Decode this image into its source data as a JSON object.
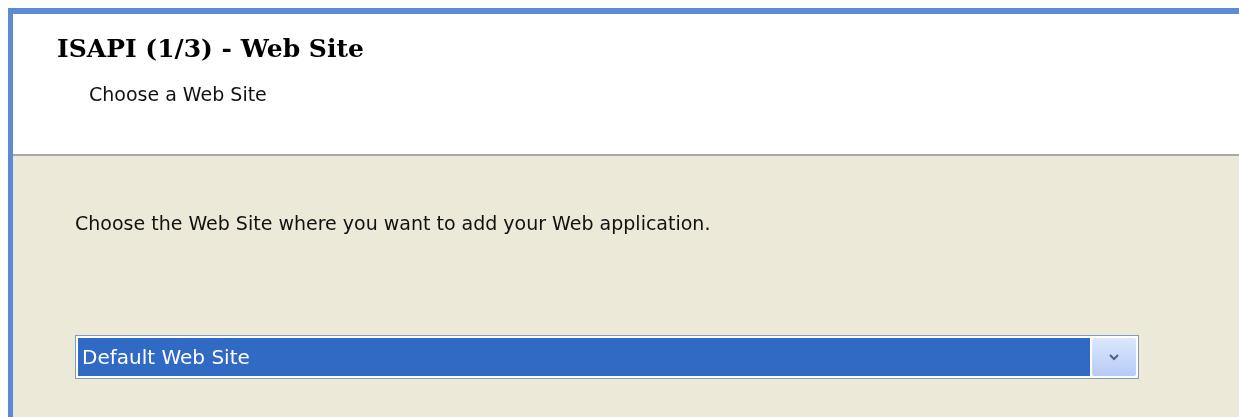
{
  "header": {
    "title": "ISAPI (1/3) - Web Site",
    "subtitle": "Choose a Web Site"
  },
  "instruction": "Choose the Web Site where you want to add your Web application.",
  "site_dropdown": {
    "value": "Default Web Site",
    "selected": true
  }
}
